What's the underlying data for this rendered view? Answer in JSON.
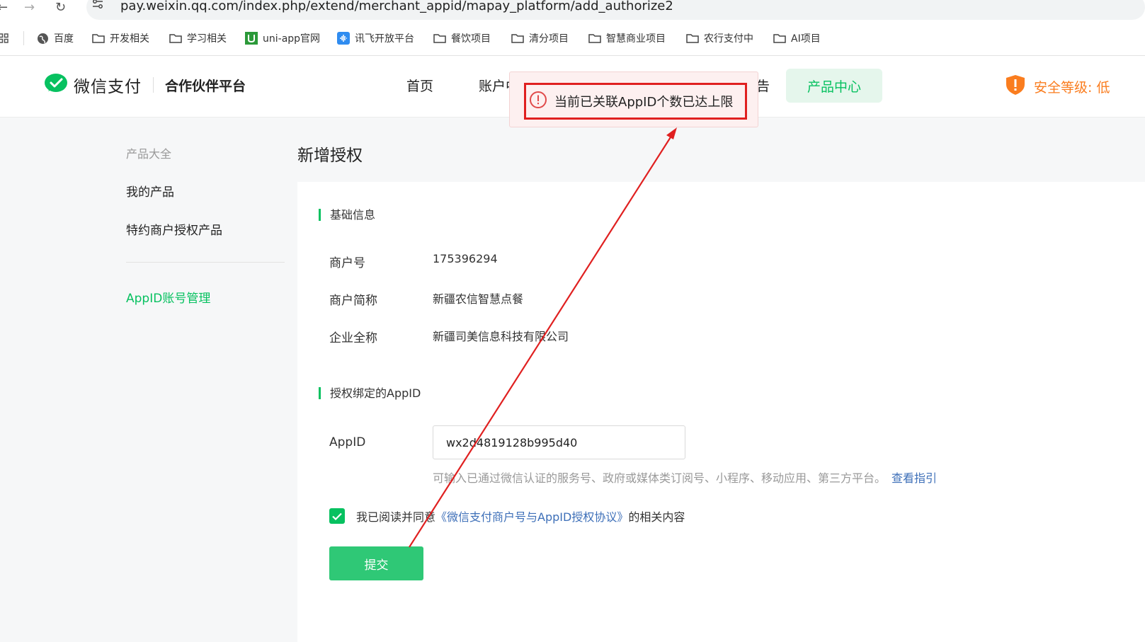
{
  "browser": {
    "url": "pay.weixin.qq.com/index.php/extend/merchant_appid/mapay_platform/add_authorize2",
    "bookmarks": [
      {
        "label": "百度",
        "icon": "globe-icon"
      },
      {
        "label": "开发相关",
        "icon": "folder-icon"
      },
      {
        "label": "学习相关",
        "icon": "folder-icon"
      },
      {
        "label": "uni-app官网",
        "icon": "uniapp-icon"
      },
      {
        "label": "讯飞开放平台",
        "icon": "xunfei-icon"
      },
      {
        "label": "餐饮项目",
        "icon": "folder-icon"
      },
      {
        "label": "清分项目",
        "icon": "folder-icon"
      },
      {
        "label": "智慧商业项目",
        "icon": "folder-icon"
      },
      {
        "label": "农行支付中",
        "icon": "folder-icon"
      },
      {
        "label": "AI项目",
        "icon": "folder-icon"
      }
    ]
  },
  "header": {
    "brand": "微信支付",
    "platform": "合作伙伴平台",
    "nav": [
      "首页",
      "账户中",
      "产品中心"
    ],
    "nav_partial_right": "告",
    "security": "安全等级: 低"
  },
  "sidebar": {
    "group_label": "产品大全",
    "items": [
      "我的产品",
      "特约商户授权产品"
    ],
    "active_item": "AppID账号管理"
  },
  "main": {
    "title": "新增授权",
    "basic_section": "基础信息",
    "fields": [
      {
        "label": "商户号",
        "value": "175396294"
      },
      {
        "label": "商户简称",
        "value": "新疆农信智慧点餐"
      },
      {
        "label": "企业全称",
        "value": "新疆司美信息科技有限公司"
      }
    ],
    "appid_section": "授权绑定的AppID",
    "appid_label": "AppID",
    "appid_value": "wx2d4819128b995d40",
    "hint": "可输入已通过微信认证的服务号、政府或媒体类订阅号、小程序、移动应用、第三方平台。",
    "hint_link": "查看指引",
    "agree_prefix": "我已阅读并同意",
    "agree_link": "《微信支付商户号与AppID授权协议》",
    "agree_suffix": "的相关内容",
    "submit": "提交"
  },
  "toast": {
    "message": "当前已关联AppID个数已达上限"
  },
  "colors": {
    "brand_green": "#07c160",
    "warning_orange": "#fa7d1f",
    "annotation_red": "#e02020",
    "link_blue": "#3d6fb8"
  }
}
